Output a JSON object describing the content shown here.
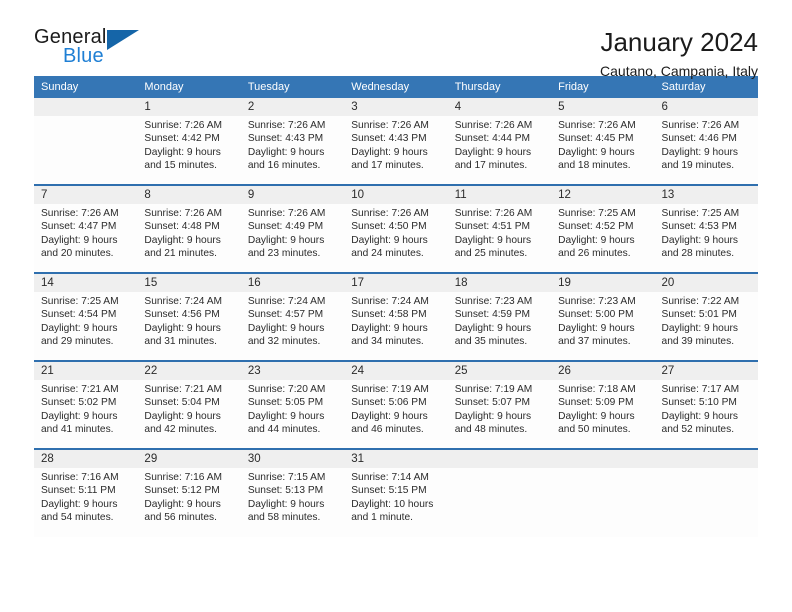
{
  "brand": {
    "name_top": "General",
    "name_bottom": "Blue",
    "triangle_color": "#1565a8",
    "blue_text_color": "#1f7fd4"
  },
  "header": {
    "title": "January 2024",
    "subtitle": "Cautano, Campania, Italy"
  },
  "theme": {
    "header_blue": "#3576b5",
    "row_divider_blue": "#2f6fae",
    "date_band_gray": "#efefef"
  },
  "weekdays": [
    "Sunday",
    "Monday",
    "Tuesday",
    "Wednesday",
    "Thursday",
    "Friday",
    "Saturday"
  ],
  "weeks": [
    {
      "days": [
        {
          "num": "",
          "sunrise": "",
          "sunset": "",
          "daylight1": "",
          "daylight2": ""
        },
        {
          "num": "1",
          "sunrise": "Sunrise: 7:26 AM",
          "sunset": "Sunset: 4:42 PM",
          "daylight1": "Daylight: 9 hours",
          "daylight2": "and 15 minutes."
        },
        {
          "num": "2",
          "sunrise": "Sunrise: 7:26 AM",
          "sunset": "Sunset: 4:43 PM",
          "daylight1": "Daylight: 9 hours",
          "daylight2": "and 16 minutes."
        },
        {
          "num": "3",
          "sunrise": "Sunrise: 7:26 AM",
          "sunset": "Sunset: 4:43 PM",
          "daylight1": "Daylight: 9 hours",
          "daylight2": "and 17 minutes."
        },
        {
          "num": "4",
          "sunrise": "Sunrise: 7:26 AM",
          "sunset": "Sunset: 4:44 PM",
          "daylight1": "Daylight: 9 hours",
          "daylight2": "and 17 minutes."
        },
        {
          "num": "5",
          "sunrise": "Sunrise: 7:26 AM",
          "sunset": "Sunset: 4:45 PM",
          "daylight1": "Daylight: 9 hours",
          "daylight2": "and 18 minutes."
        },
        {
          "num": "6",
          "sunrise": "Sunrise: 7:26 AM",
          "sunset": "Sunset: 4:46 PM",
          "daylight1": "Daylight: 9 hours",
          "daylight2": "and 19 minutes."
        }
      ]
    },
    {
      "days": [
        {
          "num": "7",
          "sunrise": "Sunrise: 7:26 AM",
          "sunset": "Sunset: 4:47 PM",
          "daylight1": "Daylight: 9 hours",
          "daylight2": "and 20 minutes."
        },
        {
          "num": "8",
          "sunrise": "Sunrise: 7:26 AM",
          "sunset": "Sunset: 4:48 PM",
          "daylight1": "Daylight: 9 hours",
          "daylight2": "and 21 minutes."
        },
        {
          "num": "9",
          "sunrise": "Sunrise: 7:26 AM",
          "sunset": "Sunset: 4:49 PM",
          "daylight1": "Daylight: 9 hours",
          "daylight2": "and 23 minutes."
        },
        {
          "num": "10",
          "sunrise": "Sunrise: 7:26 AM",
          "sunset": "Sunset: 4:50 PM",
          "daylight1": "Daylight: 9 hours",
          "daylight2": "and 24 minutes."
        },
        {
          "num": "11",
          "sunrise": "Sunrise: 7:26 AM",
          "sunset": "Sunset: 4:51 PM",
          "daylight1": "Daylight: 9 hours",
          "daylight2": "and 25 minutes."
        },
        {
          "num": "12",
          "sunrise": "Sunrise: 7:25 AM",
          "sunset": "Sunset: 4:52 PM",
          "daylight1": "Daylight: 9 hours",
          "daylight2": "and 26 minutes."
        },
        {
          "num": "13",
          "sunrise": "Sunrise: 7:25 AM",
          "sunset": "Sunset: 4:53 PM",
          "daylight1": "Daylight: 9 hours",
          "daylight2": "and 28 minutes."
        }
      ]
    },
    {
      "days": [
        {
          "num": "14",
          "sunrise": "Sunrise: 7:25 AM",
          "sunset": "Sunset: 4:54 PM",
          "daylight1": "Daylight: 9 hours",
          "daylight2": "and 29 minutes."
        },
        {
          "num": "15",
          "sunrise": "Sunrise: 7:24 AM",
          "sunset": "Sunset: 4:56 PM",
          "daylight1": "Daylight: 9 hours",
          "daylight2": "and 31 minutes."
        },
        {
          "num": "16",
          "sunrise": "Sunrise: 7:24 AM",
          "sunset": "Sunset: 4:57 PM",
          "daylight1": "Daylight: 9 hours",
          "daylight2": "and 32 minutes."
        },
        {
          "num": "17",
          "sunrise": "Sunrise: 7:24 AM",
          "sunset": "Sunset: 4:58 PM",
          "daylight1": "Daylight: 9 hours",
          "daylight2": "and 34 minutes."
        },
        {
          "num": "18",
          "sunrise": "Sunrise: 7:23 AM",
          "sunset": "Sunset: 4:59 PM",
          "daylight1": "Daylight: 9 hours",
          "daylight2": "and 35 minutes."
        },
        {
          "num": "19",
          "sunrise": "Sunrise: 7:23 AM",
          "sunset": "Sunset: 5:00 PM",
          "daylight1": "Daylight: 9 hours",
          "daylight2": "and 37 minutes."
        },
        {
          "num": "20",
          "sunrise": "Sunrise: 7:22 AM",
          "sunset": "Sunset: 5:01 PM",
          "daylight1": "Daylight: 9 hours",
          "daylight2": "and 39 minutes."
        }
      ]
    },
    {
      "days": [
        {
          "num": "21",
          "sunrise": "Sunrise: 7:21 AM",
          "sunset": "Sunset: 5:02 PM",
          "daylight1": "Daylight: 9 hours",
          "daylight2": "and 41 minutes."
        },
        {
          "num": "22",
          "sunrise": "Sunrise: 7:21 AM",
          "sunset": "Sunset: 5:04 PM",
          "daylight1": "Daylight: 9 hours",
          "daylight2": "and 42 minutes."
        },
        {
          "num": "23",
          "sunrise": "Sunrise: 7:20 AM",
          "sunset": "Sunset: 5:05 PM",
          "daylight1": "Daylight: 9 hours",
          "daylight2": "and 44 minutes."
        },
        {
          "num": "24",
          "sunrise": "Sunrise: 7:19 AM",
          "sunset": "Sunset: 5:06 PM",
          "daylight1": "Daylight: 9 hours",
          "daylight2": "and 46 minutes."
        },
        {
          "num": "25",
          "sunrise": "Sunrise: 7:19 AM",
          "sunset": "Sunset: 5:07 PM",
          "daylight1": "Daylight: 9 hours",
          "daylight2": "and 48 minutes."
        },
        {
          "num": "26",
          "sunrise": "Sunrise: 7:18 AM",
          "sunset": "Sunset: 5:09 PM",
          "daylight1": "Daylight: 9 hours",
          "daylight2": "and 50 minutes."
        },
        {
          "num": "27",
          "sunrise": "Sunrise: 7:17 AM",
          "sunset": "Sunset: 5:10 PM",
          "daylight1": "Daylight: 9 hours",
          "daylight2": "and 52 minutes."
        }
      ]
    },
    {
      "days": [
        {
          "num": "28",
          "sunrise": "Sunrise: 7:16 AM",
          "sunset": "Sunset: 5:11 PM",
          "daylight1": "Daylight: 9 hours",
          "daylight2": "and 54 minutes."
        },
        {
          "num": "29",
          "sunrise": "Sunrise: 7:16 AM",
          "sunset": "Sunset: 5:12 PM",
          "daylight1": "Daylight: 9 hours",
          "daylight2": "and 56 minutes."
        },
        {
          "num": "30",
          "sunrise": "Sunrise: 7:15 AM",
          "sunset": "Sunset: 5:13 PM",
          "daylight1": "Daylight: 9 hours",
          "daylight2": "and 58 minutes."
        },
        {
          "num": "31",
          "sunrise": "Sunrise: 7:14 AM",
          "sunset": "Sunset: 5:15 PM",
          "daylight1": "Daylight: 10 hours",
          "daylight2": "and 1 minute."
        },
        {
          "num": "",
          "sunrise": "",
          "sunset": "",
          "daylight1": "",
          "daylight2": ""
        },
        {
          "num": "",
          "sunrise": "",
          "sunset": "",
          "daylight1": "",
          "daylight2": ""
        },
        {
          "num": "",
          "sunrise": "",
          "sunset": "",
          "daylight1": "",
          "daylight2": ""
        }
      ]
    }
  ]
}
